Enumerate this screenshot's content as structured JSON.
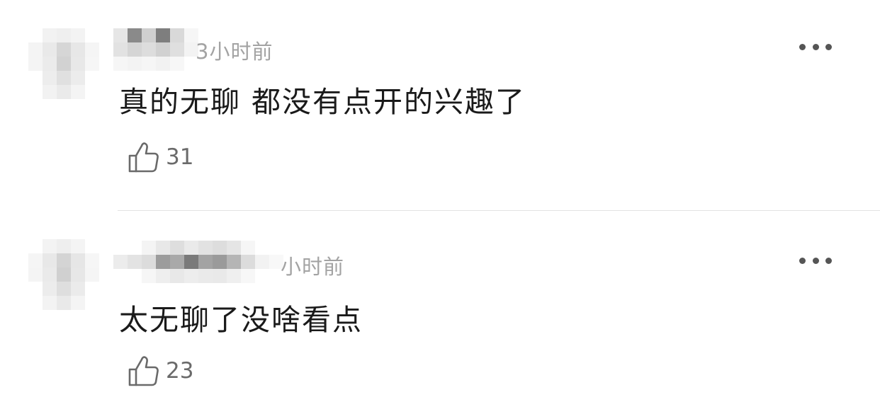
{
  "comments": [
    {
      "time": "3小时前",
      "text": "真的无聊 都没有点开的兴趣了",
      "likes": "31",
      "avatar_icon": "user-avatar-pixelated",
      "more_icon": "more-dots-icon",
      "like_icon": "thumbs-up-icon"
    },
    {
      "time": "小时前",
      "text": "太无聊了没啥看点",
      "likes": "23",
      "avatar_icon": "user-avatar-pixelated",
      "more_icon": "more-dots-icon",
      "like_icon": "thumbs-up-icon"
    }
  ],
  "colors": {
    "text_primary": "#1a1a1a",
    "text_secondary": "#a3a3a3",
    "like_count": "#6a6a6a",
    "divider": "#e2e2e2"
  }
}
